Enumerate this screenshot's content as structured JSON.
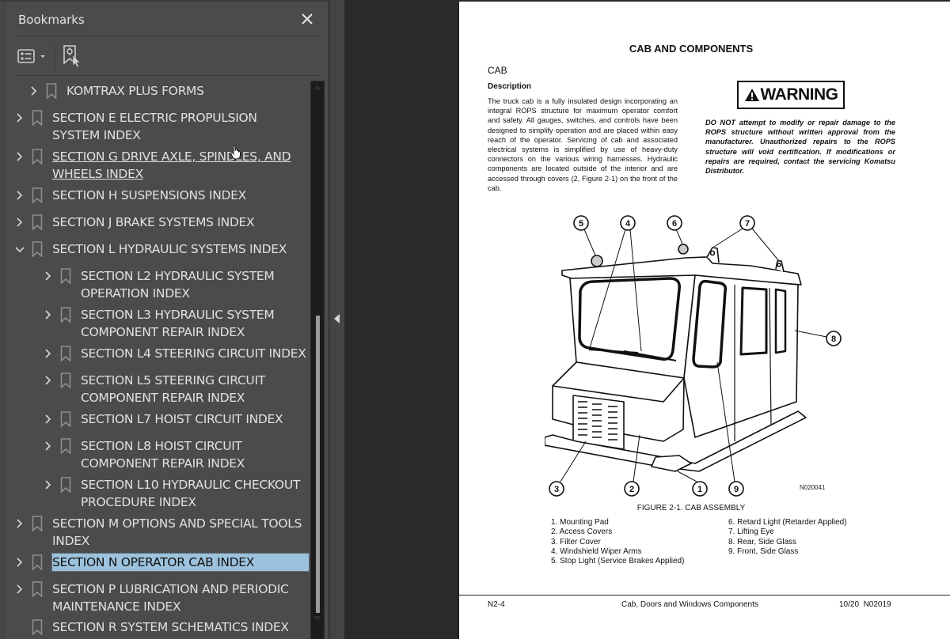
{
  "sidebar": {
    "title": "Bookmarks",
    "close_icon": "close-icon",
    "toolbar": {
      "options_icon": "list-options-icon",
      "find_bookmark_icon": "find-current-bookmark-icon"
    },
    "items": [
      {
        "label": "KOMTRAX PLUS FORMS",
        "level": 1,
        "expandable": true,
        "expanded": false
      },
      {
        "label": "SECTION E ELECTRIC PROPULSION SYSTEM INDEX",
        "level": 0,
        "expandable": true,
        "expanded": false
      },
      {
        "label": "SECTION G DRIVE AXLE, SPINDLES, AND WHEELS INDEX",
        "level": 0,
        "expandable": true,
        "expanded": false,
        "hovered": true
      },
      {
        "label": "SECTION H SUSPENSIONS INDEX",
        "level": 0,
        "expandable": true,
        "expanded": false
      },
      {
        "label": "SECTION J BRAKE SYSTEMS INDEX",
        "level": 0,
        "expandable": true,
        "expanded": false
      },
      {
        "label": "SECTION L HYDRAULIC SYSTEMS INDEX",
        "level": 0,
        "expandable": true,
        "expanded": true
      },
      {
        "label": "SECTION L2 HYDRAULIC SYSTEM OPERATION INDEX",
        "level": 1,
        "expandable": true,
        "expanded": false
      },
      {
        "label": "SECTION L3 HYDRAULIC SYSTEM COMPONENT REPAIR INDEX",
        "level": 1,
        "expandable": true,
        "expanded": false
      },
      {
        "label": "SECTION L4 STEERING CIRCUIT INDEX",
        "level": 1,
        "expandable": true,
        "expanded": false
      },
      {
        "label": "SECTION L5 STEERING CIRCUIT COMPONENT REPAIR INDEX",
        "level": 1,
        "expandable": true,
        "expanded": false
      },
      {
        "label": "SECTION L7 HOIST CIRCUIT INDEX",
        "level": 1,
        "expandable": true,
        "expanded": false
      },
      {
        "label": "SECTION L8 HOIST CIRCUIT COMPONENT REPAIR INDEX",
        "level": 1,
        "expandable": true,
        "expanded": false
      },
      {
        "label": "SECTION L10 HYDRAULIC CHECKOUT PROCEDURE INDEX",
        "level": 1,
        "expandable": true,
        "expanded": false
      },
      {
        "label": "SECTION M OPTIONS AND SPECIAL TOOLS INDEX",
        "level": 0,
        "expandable": true,
        "expanded": false
      },
      {
        "label": "SECTION N OPERATOR CAB INDEX",
        "level": 0,
        "expandable": true,
        "expanded": false,
        "selected": true
      },
      {
        "label": "SECTION P LUBRICATION AND PERIODIC MAINTENANCE INDEX",
        "level": 0,
        "expandable": true,
        "expanded": false
      },
      {
        "label": "SECTION R SYSTEM SCHEMATICS INDEX",
        "level": 0,
        "expandable": false,
        "expanded": false
      }
    ],
    "selected_color": "#9dc2dd"
  },
  "page": {
    "title": "CAB AND COMPONENTS",
    "heading": "CAB",
    "subheading": "Description",
    "body": "The truck cab is a fully insulated design incorporating an integral ROPS structure for maximum operator comfort and safety. All gauges, switches, and controls have been designed to simplify operation and are placed within easy reach of the operator. Servicing of cab and associated electrical systems is simplified by use of heavy-duty connectors on the various wiring harnesses. Hydraulic components are located outside of the interior and are accessed through covers (2, Figure 2-1) on the front of the cab.",
    "warning_label": "WARNING",
    "warning_text": "DO NOT attempt to modify or repair damage to the ROPS structure without written approval from the manufacturer. Unauthorized repairs to the ROPS structure will void certification. If modifications or repairs are required, contact the servicing Komatsu Distributor.",
    "figure_id": "N020041",
    "figure_caption": "FIGURE 2-1. CAB ASSEMBLY",
    "callouts": [
      "1",
      "2",
      "3",
      "4",
      "5",
      "6",
      "7",
      "8",
      "9"
    ],
    "legend_left": [
      "1. Mounting Pad",
      "2. Access Covers",
      "3. Filter Cover",
      "4. Windshield Wiper Arms",
      "5. Stop Light (Service Brakes Applied)"
    ],
    "legend_right": [
      "6. Retard Light (Retarder Applied)",
      "7. Lifting Eye",
      "8. Rear, Side Glass",
      "9. Front, Side Glass"
    ],
    "footer": {
      "page_number": "N2-4",
      "section_title": "Cab, Doors and Windows Components",
      "revision": "10/20  N02019"
    }
  }
}
